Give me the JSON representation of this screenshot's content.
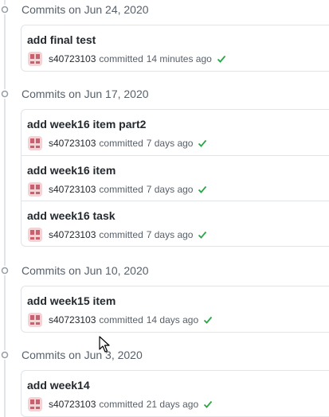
{
  "groups": [
    {
      "date_label": "Commits on Jun 24, 2020",
      "commits": [
        {
          "title": "add final test",
          "author": "s40723103",
          "verb": "committed",
          "time": "14 minutes ago"
        }
      ]
    },
    {
      "date_label": "Commits on Jun 17, 2020",
      "commits": [
        {
          "title": "add week16 item part2",
          "author": "s40723103",
          "verb": "committed",
          "time": "7 days ago"
        },
        {
          "title": "add week16 item",
          "author": "s40723103",
          "verb": "committed",
          "time": "7 days ago"
        },
        {
          "title": "add week16 task",
          "author": "s40723103",
          "verb": "committed",
          "time": "7 days ago"
        }
      ]
    },
    {
      "date_label": "Commits on Jun 10, 2020",
      "commits": [
        {
          "title": "add week15 item",
          "author": "s40723103",
          "verb": "committed",
          "time": "14 days ago"
        }
      ]
    },
    {
      "date_label": "Commits on Jun 3, 2020",
      "commits": [
        {
          "title": "add week14",
          "author": "s40723103",
          "verb": "committed",
          "time": "21 days ago"
        }
      ]
    }
  ],
  "colors": {
    "check": "#28a745",
    "avatar_bg": "#f3d3d6",
    "avatar_fg": "#c9606e",
    "muted_text": "#586069",
    "border": "#e1e4e8"
  },
  "icons": {
    "timeline_dot": "git-commit-icon",
    "status": "check-icon",
    "avatar": "identicon-avatar",
    "cursor": "mouse-pointer-icon"
  }
}
